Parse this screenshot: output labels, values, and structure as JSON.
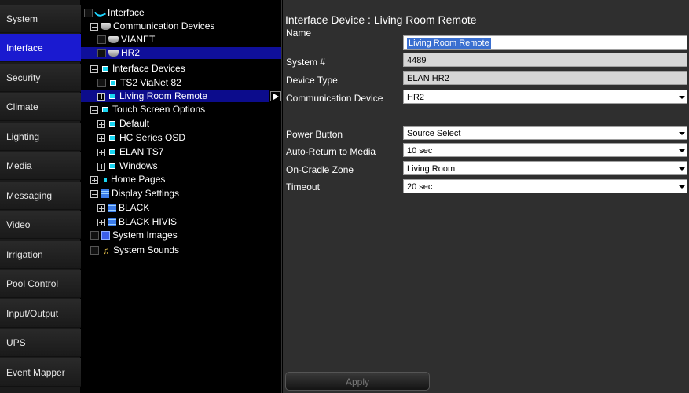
{
  "nav": {
    "items": [
      {
        "label": "System"
      },
      {
        "label": "Interface"
      },
      {
        "label": "Security"
      },
      {
        "label": "Climate"
      },
      {
        "label": "Lighting"
      },
      {
        "label": "Media"
      },
      {
        "label": "Messaging"
      },
      {
        "label": "Video"
      },
      {
        "label": "Irrigation"
      },
      {
        "label": "Pool Control"
      },
      {
        "label": "Input/Output"
      },
      {
        "label": "UPS"
      },
      {
        "label": "Event Mapper"
      }
    ],
    "active": "Interface"
  },
  "tree": {
    "nodes": [
      {
        "label": "Interface",
        "icon": "interface-icon"
      },
      {
        "label": "Communication Devices",
        "icon": "remote-icon"
      },
      {
        "label": "VIANET",
        "icon": "remote-icon"
      },
      {
        "label": "HR2",
        "icon": "remote-icon"
      },
      {
        "label": "Interface Devices",
        "icon": "device-icon"
      },
      {
        "label": "TS2 ViaNet 82",
        "icon": "device-icon"
      },
      {
        "label": "Living Room Remote",
        "icon": "device-icon"
      },
      {
        "label": "Touch Screen Options",
        "icon": "device-icon"
      },
      {
        "label": "Default",
        "icon": "device-icon"
      },
      {
        "label": "HC Series OSD",
        "icon": "device-icon"
      },
      {
        "label": "ELAN TS7",
        "icon": "device-icon"
      },
      {
        "label": "Windows",
        "icon": "device-icon"
      },
      {
        "label": "Home Pages",
        "icon": "page-icon"
      },
      {
        "label": "Display Settings",
        "icon": "display-icon"
      },
      {
        "label": "BLACK",
        "icon": "display-icon"
      },
      {
        "label": "BLACK HIVIS",
        "icon": "display-icon"
      },
      {
        "label": "System Images",
        "icon": "images-icon"
      },
      {
        "label": "System Sounds",
        "icon": "sound-icon"
      }
    ]
  },
  "main": {
    "heading": "Interface Device : Living Room Remote",
    "fields": {
      "name": {
        "label": "Name",
        "value": "Living Room Remote"
      },
      "system_no": {
        "label": "System #",
        "value": "4489"
      },
      "device_type": {
        "label": "Device Type",
        "value": "ELAN HR2"
      },
      "comm_device": {
        "label": "Communication Device",
        "value": "HR2"
      },
      "power_button": {
        "label": "Power Button",
        "value": "Source Select"
      },
      "auto_return": {
        "label": "Auto-Return to Media",
        "value": "10 sec"
      },
      "cradle_zone": {
        "label": "On-Cradle Zone",
        "value": "Living Room"
      },
      "timeout": {
        "label": "Timeout",
        "value": "20 sec"
      }
    },
    "apply_label": "Apply"
  },
  "colors": {
    "nav_active": "#1a1ad0",
    "tree_selected": "#0f0f9a",
    "panel_bg": "#2f2f2f"
  }
}
